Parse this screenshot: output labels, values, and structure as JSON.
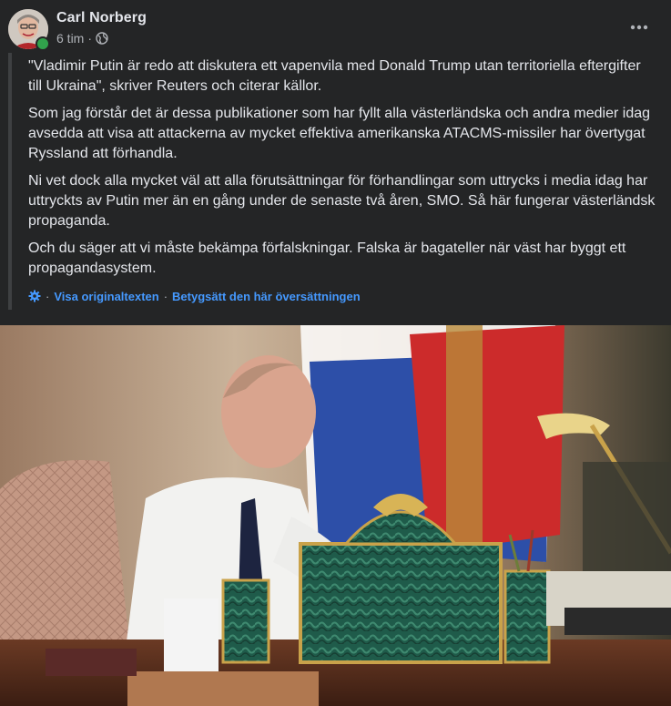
{
  "post": {
    "author": "Carl Norberg",
    "time": "6 tim",
    "separator": "·",
    "privacy_icon": "globe-icon",
    "more_icon": "more-options-icon",
    "paragraphs": [
      "\"Vladimir Putin är redo att diskutera ett vapenvila med Donald Trump utan territoriella eftergifter till Ukraina\", skriver Reuters och citerar källor.",
      "Som jag förstår det är dessa publikationer som har fyllt alla västerländska och andra medier idag avsedda att visa att attackerna av mycket effektiva amerikanska ATACMS-missiler har övertygat Ryssland att förhandla.",
      "Ni vet dock alla mycket väl att alla förutsättningar för förhandlingar som uttrycks i media idag har uttryckts av Putin mer än en gång under de senaste två åren, SMO. Så här fungerar västerländsk propaganda.",
      "Och du säger att vi måste bekämpa förfalskningar. Falska är bagateller när väst har byggt ett propagandasystem."
    ],
    "translation": {
      "icon": "settings-gear-icon",
      "sep": "·",
      "show_original": "Visa originaltexten",
      "rate": "Betygsätt den här översättningen"
    },
    "photo": {
      "subject": "man-at-desk-photo"
    }
  },
  "colors": {
    "background": "#242526",
    "text_primary": "#e4e6eb",
    "text_secondary": "#b0b3b8",
    "link": "#4599ff",
    "online": "#31a24c"
  }
}
